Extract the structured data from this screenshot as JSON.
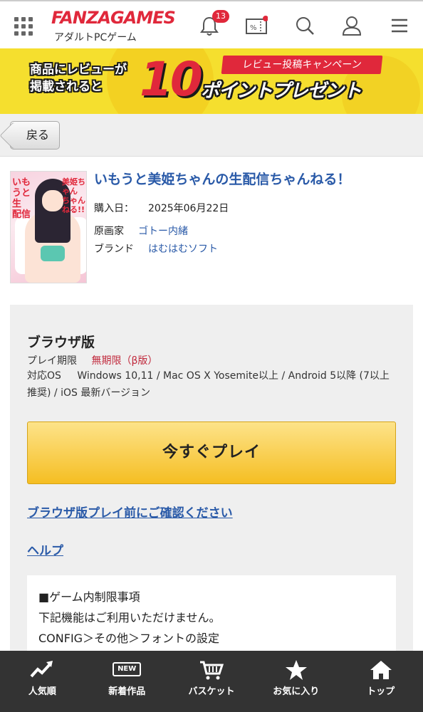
{
  "header": {
    "logo_main": "FANZAGAMES",
    "logo_sub": "アダルトPCゲーム",
    "notification_count": "13",
    "icons": [
      "grid-menu-icon",
      "bell-icon",
      "coupon-icon",
      "search-icon",
      "user-icon",
      "hamburger-icon"
    ]
  },
  "banner": {
    "left_text": "商品にレビューが\n掲載されると",
    "big_number": "10",
    "tag": "レビュー投稿キャンペーン",
    "sub": "ポイントプレゼント"
  },
  "back_label": "戻る",
  "product": {
    "title": "いもうと美姫ちゃんの生配信ちゃんねる！",
    "purchase_label": "購入日：",
    "purchase_date": "2025年06月22日",
    "artist_label": "原画家",
    "artist": "ゴトー内緒",
    "brand_label": "ブランド",
    "brand": "はむはむソフト"
  },
  "play": {
    "version_title": "ブラウザ版",
    "period_label": "プレイ期限",
    "period_value": "無期限（β版）",
    "os_label": "対応OS",
    "os_value": "Windows 10,11 / Mac OS X Yosemite以上 / Android 5以降 (7以上推奨) / iOS 最新バージョン",
    "play_button": "今すぐプレイ",
    "confirm_link": "ブラウザ版プレイ前にご確認ください",
    "help_link": "ヘルプ",
    "notice_title": "■ゲーム内制限事項",
    "notice_line1": "下記機能はご利用いただけません。",
    "notice_line2": "CONFIG＞その他＞フォントの設定"
  },
  "bottom_nav": [
    {
      "label": "人気順",
      "icon": "trend-icon"
    },
    {
      "label": "新着作品",
      "icon": "new-icon"
    },
    {
      "label": "バスケット",
      "icon": "cart-icon"
    },
    {
      "label": "お気に入り",
      "icon": "star-icon"
    },
    {
      "label": "トップ",
      "icon": "home-icon"
    }
  ],
  "colors": {
    "brand_red": "#e0283b",
    "link_blue": "#2a5aa8",
    "play_yellow": "#f5be22",
    "banner_yellow": "#f5df2e",
    "nav_bg": "#333333"
  }
}
